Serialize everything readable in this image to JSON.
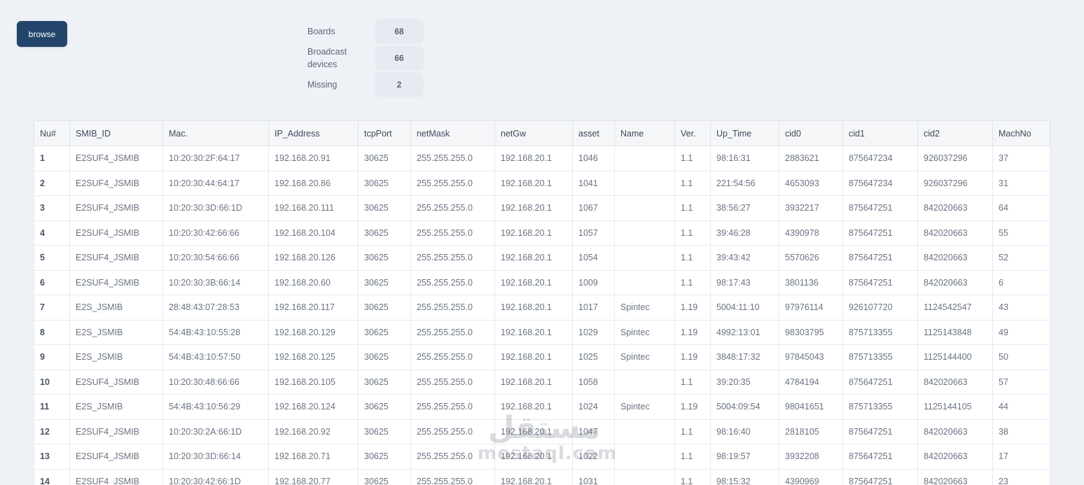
{
  "toolbar": {
    "browse_label": "browse"
  },
  "stats": [
    {
      "label": "Boards",
      "value": "68"
    },
    {
      "label": "Broadcast devices",
      "value": "66"
    },
    {
      "label": "Missing",
      "value": "2"
    }
  ],
  "table": {
    "columns": [
      "Nu#",
      "SMIB_ID",
      "Mac.",
      "IP_Address",
      "tcpPort",
      "netMask",
      "netGw",
      "asset",
      "Name",
      "Ver.",
      "Up_Time",
      "cid0",
      "cid1",
      "cid2",
      "MachNo"
    ],
    "rows": [
      [
        "1",
        "E2SUF4_JSMIB",
        "10:20:30:2F:64:17",
        "192.168.20.91",
        "30625",
        "255.255.255.0",
        "192.168.20.1",
        "1046",
        "",
        "1.1",
        "98:16:31",
        "2883621",
        "875647234",
        "926037296",
        "37"
      ],
      [
        "2",
        "E2SUF4_JSMIB",
        "10:20:30:44:64:17",
        "192.168.20.86",
        "30625",
        "255.255.255.0",
        "192.168.20.1",
        "1041",
        "",
        "1.1",
        "221:54:56",
        "4653093",
        "875647234",
        "926037296",
        "31"
      ],
      [
        "3",
        "E2SUF4_JSMIB",
        "10:20:30:3D:66:1D",
        "192.168.20.111",
        "30625",
        "255.255.255.0",
        "192.168.20.1",
        "1067",
        "",
        "1.1",
        "38:56:27",
        "3932217",
        "875647251",
        "842020663",
        "64"
      ],
      [
        "4",
        "E2SUF4_JSMIB",
        "10:20:30:42:66:66",
        "192.168.20.104",
        "30625",
        "255.255.255.0",
        "192.168.20.1",
        "1057",
        "",
        "1.1",
        "39:46:28",
        "4390978",
        "875647251",
        "842020663",
        "55"
      ],
      [
        "5",
        "E2SUF4_JSMIB",
        "10:20:30:54:66:66",
        "192.168.20.126",
        "30625",
        "255.255.255.0",
        "192.168.20.1",
        "1054",
        "",
        "1.1",
        "39:43:42",
        "5570626",
        "875647251",
        "842020663",
        "52"
      ],
      [
        "6",
        "E2SUF4_JSMIB",
        "10:20:30:3B:66:14",
        "192.168.20.60",
        "30625",
        "255.255.255.0",
        "192.168.20.1",
        "1009",
        "",
        "1.1",
        "98:17:43",
        "3801136",
        "875647251",
        "842020663",
        "6"
      ],
      [
        "7",
        "E2S_JSMIB",
        "28:48:43:07:28:53",
        "192.168.20.117",
        "30625",
        "255.255.255.0",
        "192.168.20.1",
        "1017",
        "Spintec",
        "1.19",
        "5004:11:10",
        "97976114",
        "926107720",
        "1124542547",
        "43"
      ],
      [
        "8",
        "E2S_JSMIB",
        "54:4B:43:10:55:28",
        "192.168.20.129",
        "30625",
        "255.255.255.0",
        "192.168.20.1",
        "1029",
        "Spintec",
        "1.19",
        "4992:13:01",
        "98303795",
        "875713355",
        "1125143848",
        "49"
      ],
      [
        "9",
        "E2S_JSMIB",
        "54:4B:43:10:57:50",
        "192.168.20.125",
        "30625",
        "255.255.255.0",
        "192.168.20.1",
        "1025",
        "Spintec",
        "1.19",
        "3848:17:32",
        "97845043",
        "875713355",
        "1125144400",
        "50"
      ],
      [
        "10",
        "E2SUF4_JSMIB",
        "10:20:30:48:66:66",
        "192.168.20.105",
        "30625",
        "255.255.255.0",
        "192.168.20.1",
        "1058",
        "",
        "1.1",
        "39:20:35",
        "4784194",
        "875647251",
        "842020663",
        "57"
      ],
      [
        "11",
        "E2S_JSMIB",
        "54:4B:43:10:56:29",
        "192.168.20.124",
        "30625",
        "255.255.255.0",
        "192.168.20.1",
        "1024",
        "Spintec",
        "1.19",
        "5004:09:54",
        "98041651",
        "875713355",
        "1125144105",
        "44"
      ],
      [
        "12",
        "E2SUF4_JSMIB",
        "10:20:30:2A:66:1D",
        "192.168.20.92",
        "30625",
        "255.255.255.0",
        "192.168.20.1",
        "1047",
        "",
        "1.1",
        "98:16:40",
        "2818105",
        "875647251",
        "842020663",
        "38"
      ],
      [
        "13",
        "E2SUF4_JSMIB",
        "10:20:30:3D:66:14",
        "192.168.20.71",
        "30625",
        "255.255.255.0",
        "192.168.20.1",
        "1022",
        "",
        "1.1",
        "98:19:57",
        "3932208",
        "875647251",
        "842020663",
        "17"
      ],
      [
        "14",
        "E2SUF4_JSMIB",
        "10:20:30:42:66:1D",
        "192.168.20.77",
        "30625",
        "255.255.255.0",
        "192.168.20.1",
        "1031",
        "",
        "1.1",
        "98:15:32",
        "4390969",
        "875647251",
        "842020663",
        "23"
      ]
    ]
  },
  "watermark": {
    "arabic": "مستقل",
    "latin": "mostaql.com"
  }
}
